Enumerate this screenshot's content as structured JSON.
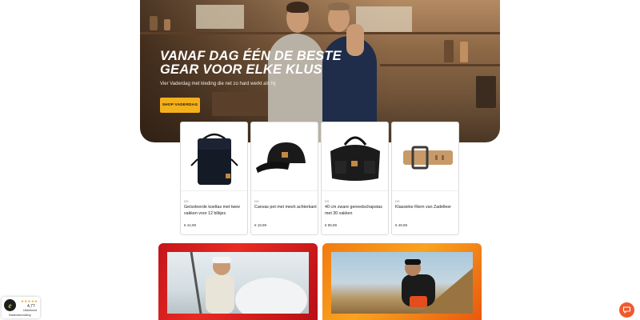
{
  "hero": {
    "title": "VANAF DAG ÉÉN DE BESTE GEAR VOOR ELKE KLUS",
    "subtitle": "Vier Vaderdag met kleding die net zo hard werkt als hij",
    "cta_label": "SHOP VADERDAG"
  },
  "products": [
    {
      "tag": "DS",
      "name": "Geïsoleerde koeltas met twee vakken voor 12 blikjes",
      "price": "€ 44,99",
      "image_icon": "cooler-bag-icon"
    },
    {
      "tag": "DS",
      "name": "Canvas pet met mesh achterkant",
      "price": "€ 18,99",
      "image_icon": "cap-icon"
    },
    {
      "tag": "DS",
      "name": "40 cm zware gereedschapstas met 30 vakken",
      "price": "€ 89,99",
      "image_icon": "tool-bag-icon"
    },
    {
      "tag": "DS",
      "name": "Klassieke Riem van Zadelleer",
      "price": "€ 49,99",
      "image_icon": "belt-icon"
    }
  ],
  "trust_badge": {
    "stars": "★★★★★",
    "score": "4,77",
    "label": "Uitstekend",
    "sub": "Klantenbeoordeling"
  },
  "colors": {
    "cta_yellow": "#f4b01b",
    "banner_red": "#e82b22",
    "banner_orange": "#f9a31f",
    "chat_orange": "#ef5a2d"
  }
}
